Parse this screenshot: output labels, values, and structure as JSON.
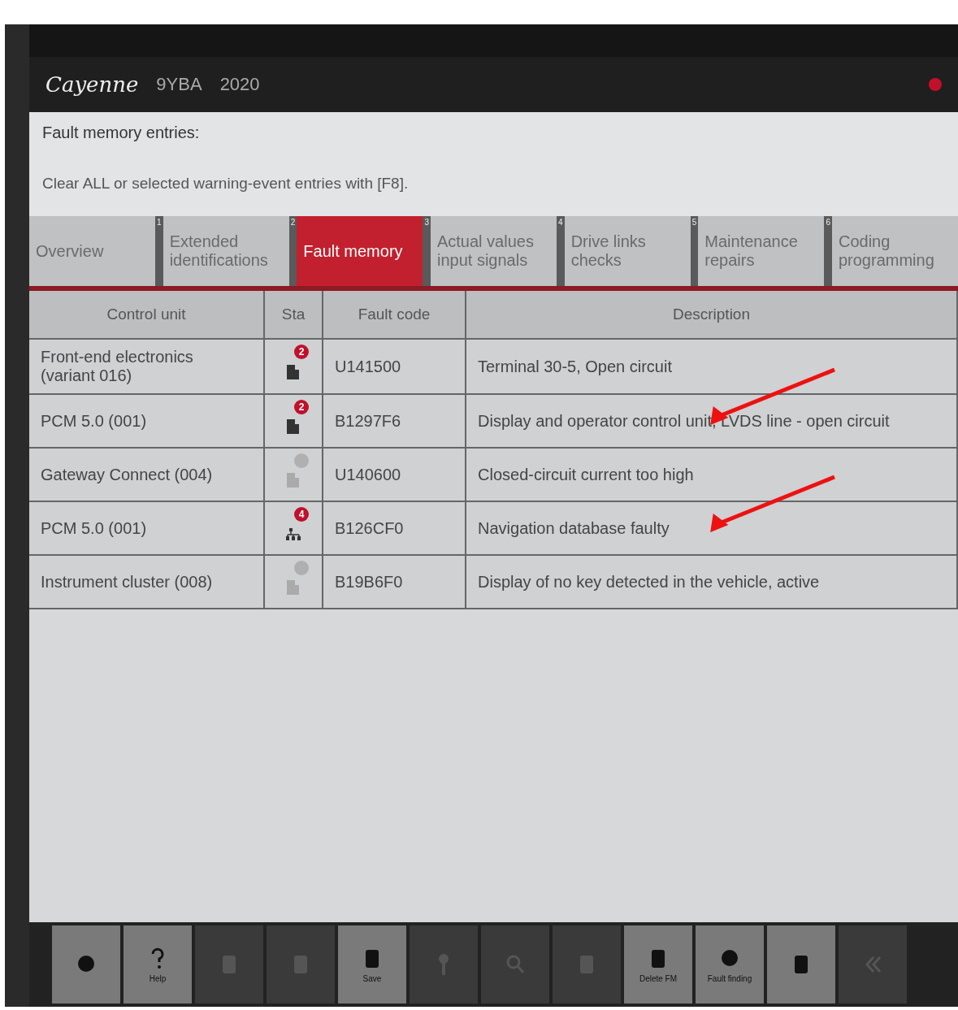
{
  "header": {
    "model": "Cayenne",
    "type_code": "9YBA",
    "year": "2020"
  },
  "info": {
    "title": "Fault memory entries:",
    "hint": "Clear ALL or selected warning-event entries with [F8]."
  },
  "tabs": [
    {
      "label": "Overview",
      "number": "1",
      "selected": false
    },
    {
      "label": "Extended identifications",
      "number": "2",
      "selected": false
    },
    {
      "label": "Fault memory",
      "number": "3",
      "selected": true
    },
    {
      "label": "Actual values input signals",
      "number": "4",
      "selected": false
    },
    {
      "label": "Drive links checks",
      "number": "5",
      "selected": false
    },
    {
      "label": "Maintenance repairs",
      "number": "6",
      "selected": false
    },
    {
      "label": "Coding programming",
      "selected": false
    }
  ],
  "table": {
    "columns": [
      "Control unit",
      "Sta",
      "Fault code",
      "Description"
    ],
    "rows": [
      {
        "control_unit": "Front-end electronics (variant 016)",
        "status": {
          "kind": "module",
          "active": true,
          "count": "2"
        },
        "fault_code": "U141500",
        "description": "Terminal 30-5, Open circuit",
        "arrow": false
      },
      {
        "control_unit": "PCM 5.0 (001)",
        "status": {
          "kind": "module",
          "active": true,
          "count": "2"
        },
        "fault_code": "B1297F6",
        "description": "Display and operator control unit, LVDS line - open circuit",
        "arrow": true
      },
      {
        "control_unit": "Gateway Connect (004)",
        "status": {
          "kind": "module",
          "active": false
        },
        "fault_code": "U140600",
        "description": "Closed-circuit current too high",
        "arrow": false
      },
      {
        "control_unit": "PCM 5.0 (001)",
        "status": {
          "kind": "network",
          "active": true,
          "count": "4"
        },
        "fault_code": "B126CF0",
        "description": "Navigation database faulty",
        "arrow": true
      },
      {
        "control_unit": "Instrument cluster (008)",
        "status": {
          "kind": "module",
          "active": false
        },
        "fault_code": "B19B6F0",
        "description": "Display of no key detected in the vehicle, active",
        "arrow": false
      }
    ]
  },
  "toolbar": [
    {
      "kind": "globe",
      "enabled": true
    },
    {
      "kind": "help",
      "label": "Help",
      "enabled": true
    },
    {
      "kind": "chat",
      "enabled": false
    },
    {
      "kind": "chart",
      "enabled": false
    },
    {
      "kind": "save",
      "label": "Save",
      "enabled": true
    },
    {
      "kind": "key",
      "enabled": false
    },
    {
      "kind": "search",
      "enabled": false
    },
    {
      "kind": "wrench",
      "enabled": false
    },
    {
      "kind": "delete",
      "label": "Delete FM",
      "enabled": true
    },
    {
      "kind": "fault",
      "label": "Fault finding",
      "enabled": true
    },
    {
      "kind": "doc",
      "enabled": true
    },
    {
      "kind": "back",
      "enabled": false
    }
  ]
}
